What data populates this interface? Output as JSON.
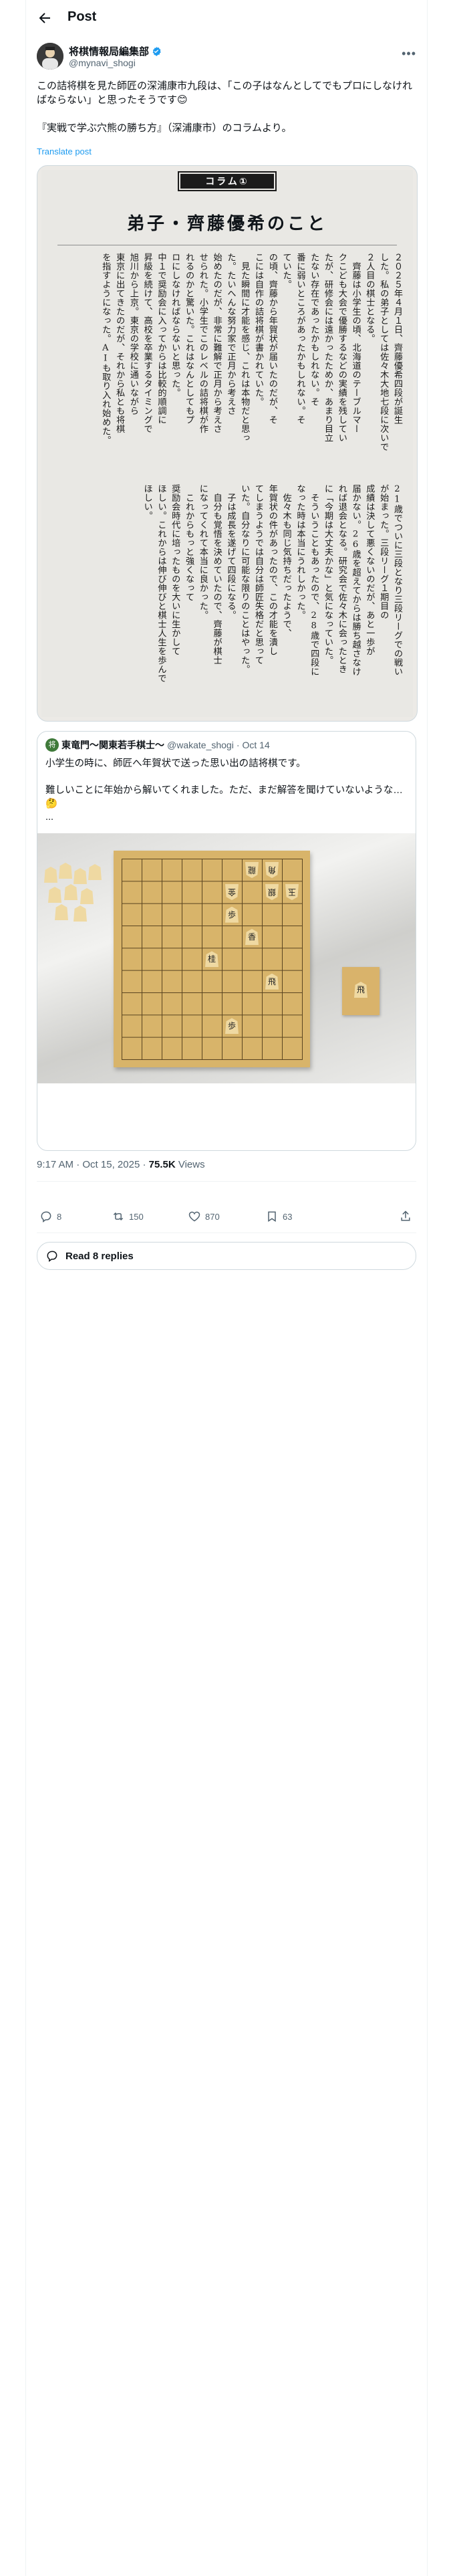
{
  "header": {
    "title": "Post"
  },
  "author": {
    "name": "将棋情報局編集部",
    "handle": "@mynavi_shogi"
  },
  "tweet": {
    "text": "この詰将棋を見た師匠の深浦康市九段は、「この子はなんとしてでもプロにしなければならない」と思ったそうです😊\n\n『実戦で学ぶ穴熊の勝ち方』（深浦康市）のコラムより。",
    "translate_label": "Translate post"
  },
  "article": {
    "badge": "コラム①",
    "title": "弟子・齊藤優希のこと",
    "columns_top": [
      "２０２５年４月１日、齊藤優希四段が誕生",
      "した。私の弟子としては佐々木大地七段に次いで",
      "２人目の棋士となる。",
      "　齊藤は小学生の頃、北海道のテーブルマー",
      "クこども大会で優勝するなどの実績を残してい",
      "たが、研修会には遠かったためか、あまり目立",
      "たない存在であったかもしれない。そ",
      "番に弱いところがあったかもしれない。そ",
      "ていた。",
      "の頃、齊藤から年賀状が届いたのだが、そ",
      "こには自作の詰将棋が書かれていた。",
      "　見た瞬間に才能を感じ、これは本物だと思っ",
      "た。たいへんな努力家で正月から考えさ",
      "始めたのだが、非常に難解で正月から考えさ",
      "せられた。小学生でこのレベルの詰将棋が作",
      "れるのかと驚いた。これはなんとしてもプ",
      "ロにしなければならないと思った。",
      "中１で奨励会に入ってからは比較的順調に",
      "昇級を続けて、高校を卒業するタイミングで",
      "旭川から上京。東京の学校に通いながら",
      "東京に出てきたのだが、それから私とも将棋",
      "を指すようになった。AIも取り入れ始めた。"
    ],
    "columns_bottom": [
      "21歳でついに三段となり三段リーグでの戦い",
      "が始まった。三段リーグ１期目の",
      "成績は決して悪くないのだが、あと一歩が",
      "届かない。26歳を超えてからは勝ち越さなけ",
      "れば退会となる。研究会で佐々木に会ったとき",
      "に「今期は大丈夫かな」と気になっていた。",
      "　そういうこともあったので、28歳で四段に",
      "なった時は本当にうれしかった。",
      "　佐々木も同じ気持ちだったようで、",
      "年賀状の件があったので、この才能を潰し",
      "てしまうようでは自分は師匠失格だと思って",
      "いた。自分なりに可能な限りのことはやった。",
      "　子は成長を遂げて四段になる。",
      "　自分も覚悟を決めていたので、齊藤が棋士",
      "になってくれて本当に良かった。",
      "　これからもっと強くなって",
      "奨励会時代に培ったものを大いに生かして",
      "ほしい。これからは伸び伸びと棋士人生を歩んで",
      "ほしい。"
    ]
  },
  "quote": {
    "name": "東竜門〜関東若手棋士〜",
    "handle": "@wakate_shogi",
    "date": "Oct 14",
    "text": "小学生の時に、師匠へ年賀状で送った思い出の詰将棋です。\n\n難しいことに年始から解いてくれました。ただ、まだ解答を聞けていないような…🤔\n...",
    "board_pieces": [
      {
        "char": "龍"
      },
      {
        "char": "角"
      },
      {
        "char": "金"
      },
      {
        "char": "銀"
      },
      {
        "char": "玉"
      },
      {
        "char": "歩"
      },
      {
        "char": "香"
      },
      {
        "char": "桂"
      },
      {
        "char": "飛"
      },
      {
        "char": "歩"
      }
    ]
  },
  "meta": {
    "time": "9:17 AM",
    "date": "Oct 15, 2025",
    "views_count": "75.5K",
    "views_label": "Views"
  },
  "actions": {
    "replies": "8",
    "reposts": "150",
    "likes": "870",
    "bookmarks": "63"
  },
  "read_replies": "Read 8 replies",
  "colors": {
    "accent": "#1d9bf0",
    "muted": "#536471",
    "border": "#cfd9de"
  },
  "icons": [
    "back-arrow-icon",
    "verified-icon",
    "more-icon",
    "reply-icon",
    "repost-icon",
    "like-icon",
    "bookmark-icon",
    "share-icon",
    "speech-bubble-icon"
  ]
}
